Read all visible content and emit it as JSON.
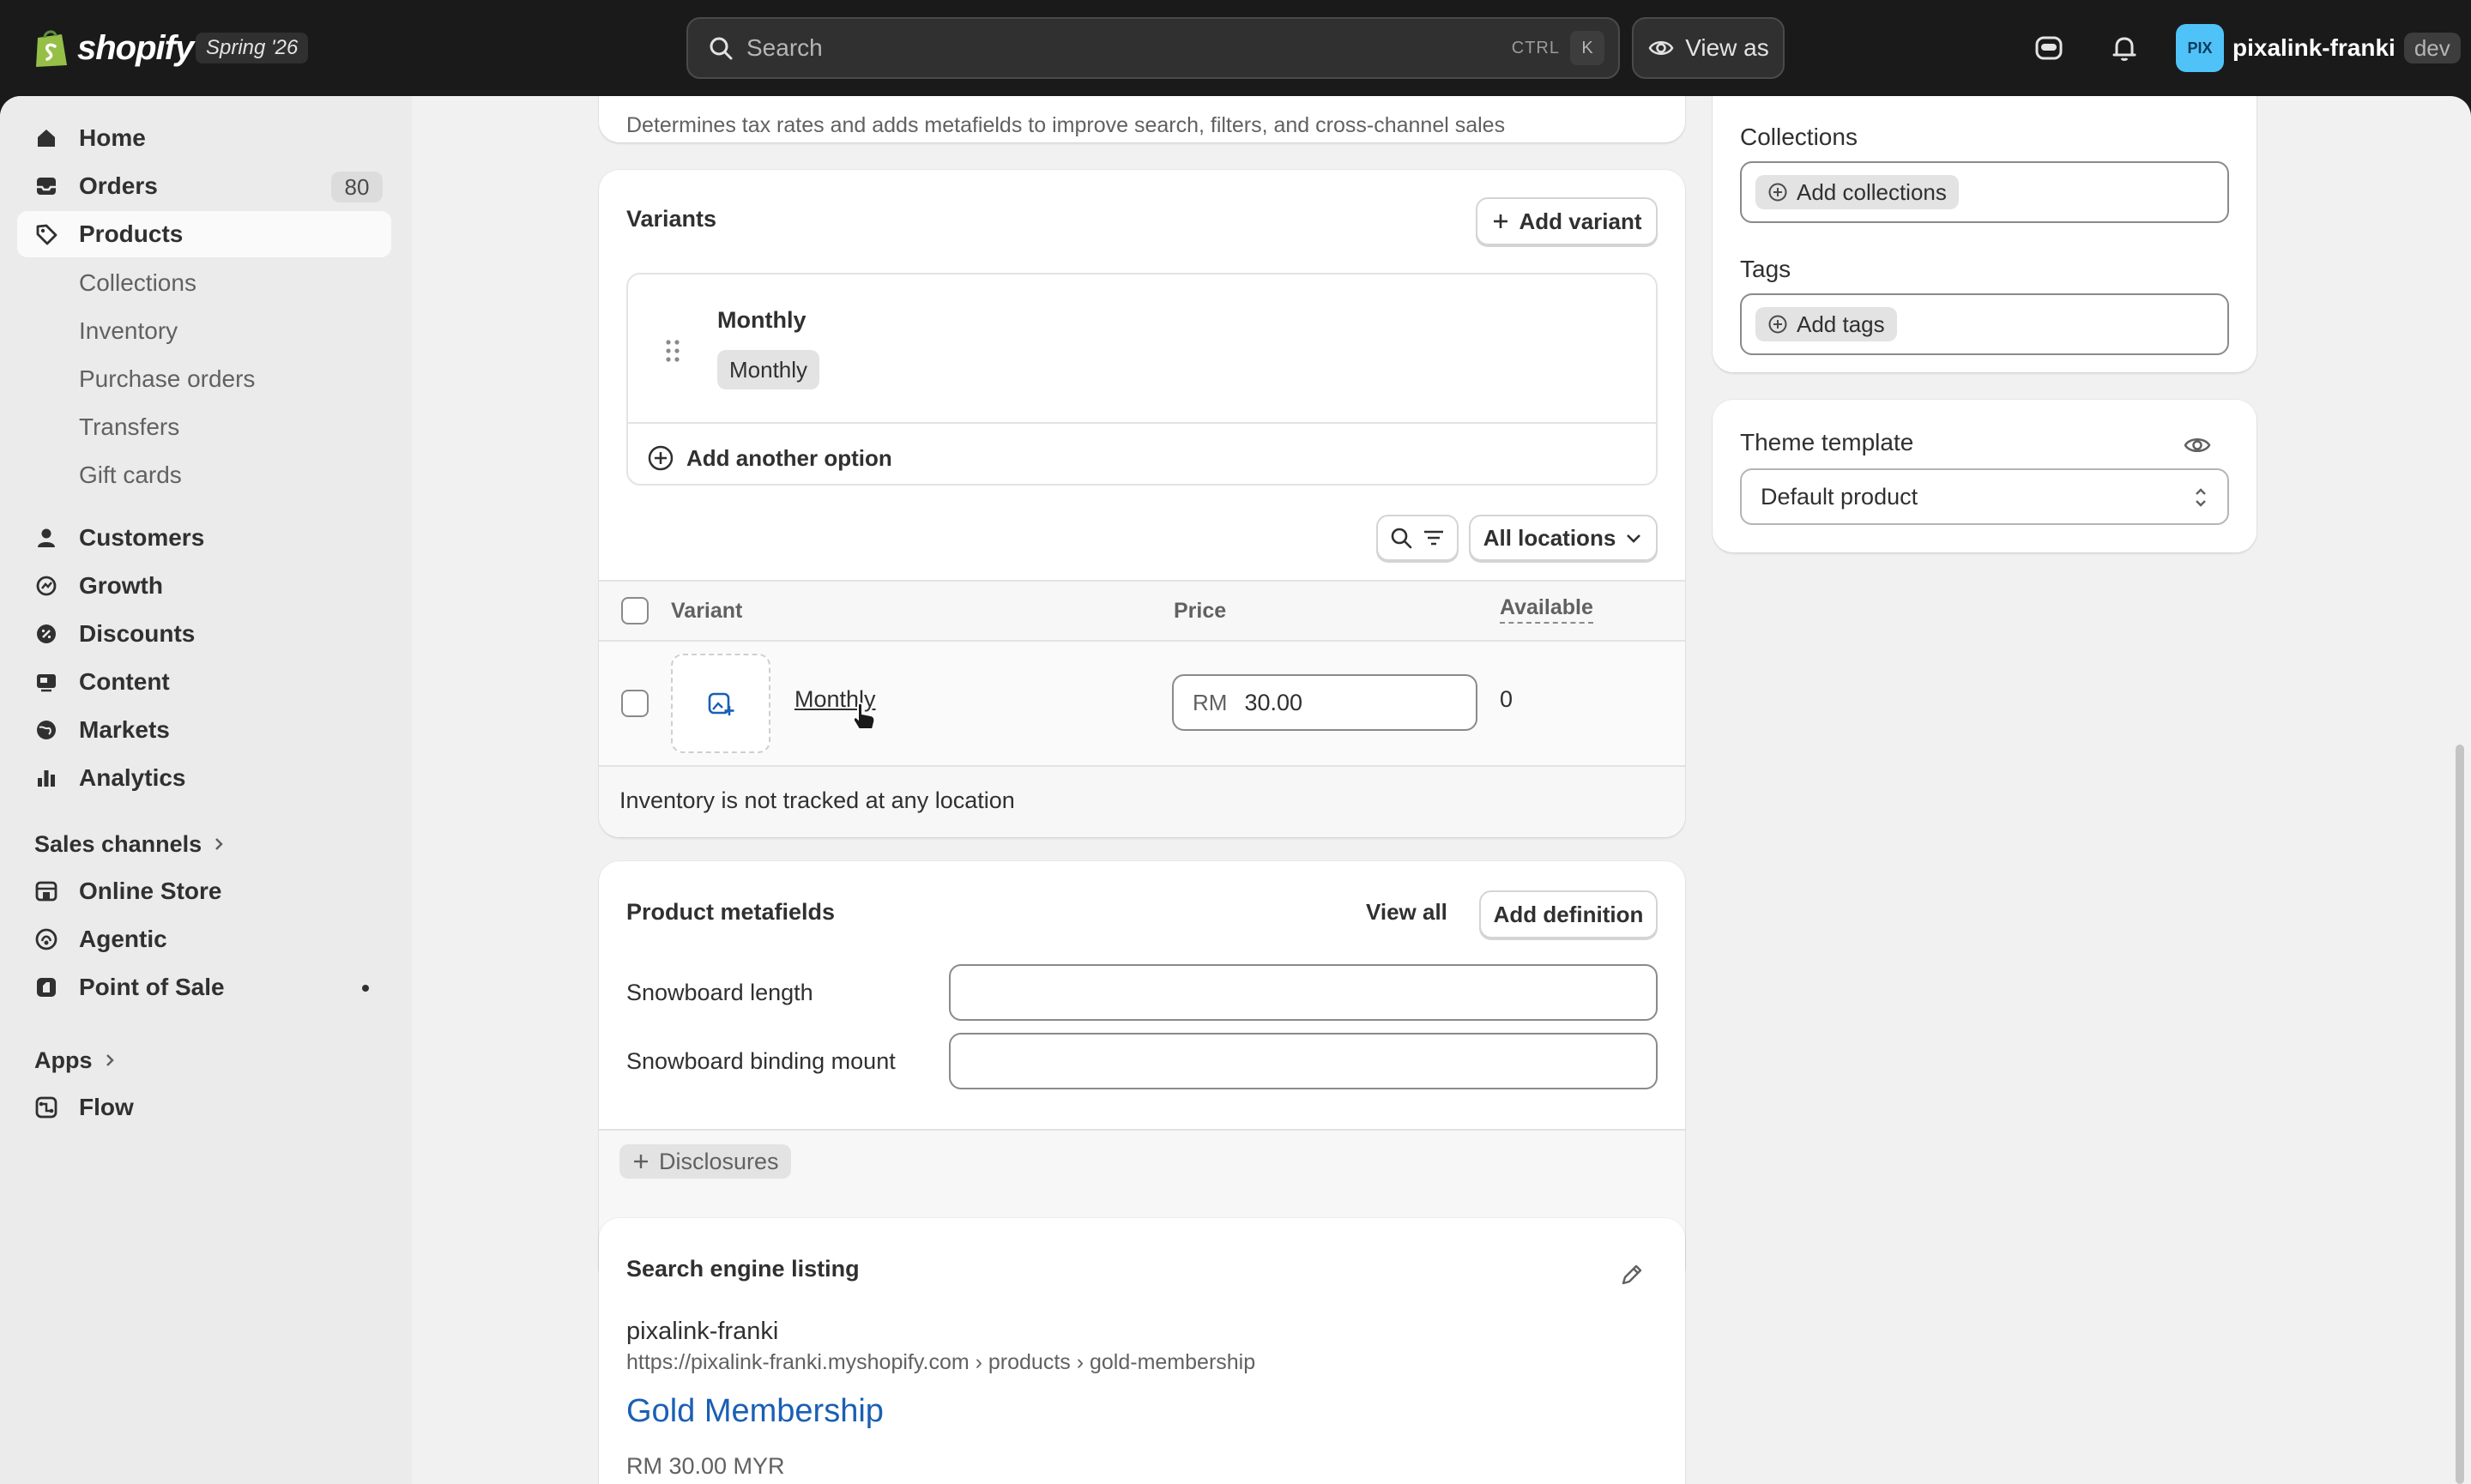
{
  "topbar": {
    "brand": "shopify",
    "edition": "Spring '26",
    "search_placeholder": "Search",
    "shortcut_ctrl": "CTRL",
    "shortcut_key": "K",
    "view_as": "View as",
    "avatar_initials": "PIX",
    "store_name": "pixalink-franki",
    "env_badge": "dev"
  },
  "sidebar": {
    "home": "Home",
    "orders": "Orders",
    "orders_count": "80",
    "products": "Products",
    "products_sub": [
      "Collections",
      "Inventory",
      "Purchase orders",
      "Transfers",
      "Gift cards"
    ],
    "customers": "Customers",
    "growth": "Growth",
    "discounts": "Discounts",
    "content": "Content",
    "markets": "Markets",
    "analytics": "Analytics",
    "sales_channels": "Sales channels",
    "online_store": "Online Store",
    "agentic": "Agentic",
    "point_of_sale": "Point of Sale",
    "apps": "Apps",
    "flow": "Flow"
  },
  "category_card": {
    "help_text": "Determines tax rates and adds metafields to improve search, filters, and cross-channel sales"
  },
  "variants": {
    "title": "Variants",
    "add_variant": "Add variant",
    "option_name": "Monthly",
    "option_value": "Monthly",
    "add_option": "Add another option",
    "all_locations": "All locations",
    "col_variant": "Variant",
    "col_price": "Price",
    "col_available": "Available",
    "rows": [
      {
        "name": "Monthly",
        "currency": "RM",
        "price": "30.00",
        "available": "0"
      }
    ],
    "inventory_note": "Inventory is not tracked at any location"
  },
  "metafields": {
    "title": "Product metafields",
    "view_all": "View all",
    "add_definition": "Add definition",
    "field_1": "Snowboard length",
    "field_2": "Snowboard binding mount",
    "disclosures": "Disclosures"
  },
  "seo": {
    "title": "Search engine listing",
    "store": "pixalink-franki",
    "url": "https://pixalink-franki.myshopify.com › products › gold-membership",
    "page_title": "Gold Membership",
    "price": "RM 30.00 MYR"
  },
  "organization": {
    "collections_label": "Collections",
    "add_collections": "Add collections",
    "tags_label": "Tags",
    "add_tags": "Add tags"
  },
  "theme": {
    "label": "Theme template",
    "value": "Default product"
  },
  "colors": {
    "topbar_bg": "#1a1a1a",
    "page_bg": "#f1f1f1",
    "sidebar_bg": "#ebebeb",
    "card_bg": "#ffffff",
    "link_blue": "#1a5fb4",
    "avatar_bg": "#4fc3f7"
  }
}
